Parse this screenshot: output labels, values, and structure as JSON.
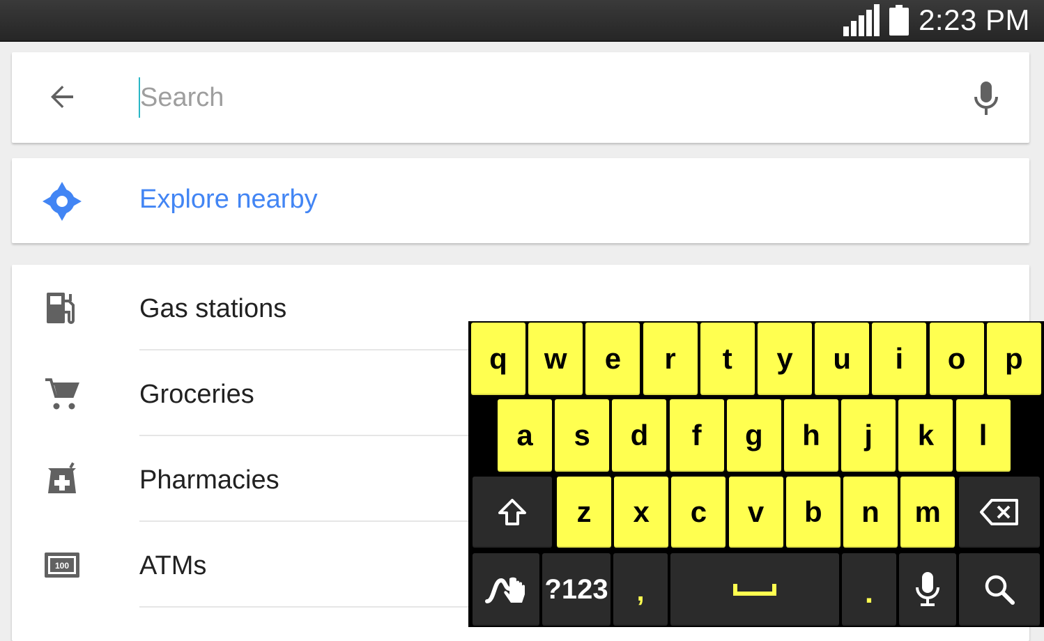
{
  "status_bar": {
    "time": "2:23 PM",
    "signal_icon": "signal-icon",
    "battery_icon": "battery-icon"
  },
  "search": {
    "placeholder": "Search",
    "value": "",
    "back_icon": "arrow-back-icon",
    "mic_icon": "microphone-icon"
  },
  "explore": {
    "label": "Explore nearby",
    "icon": "explore-compass-icon",
    "color": "#4285f4"
  },
  "categories": [
    {
      "label": "Gas stations",
      "icon": "gas-station-icon"
    },
    {
      "label": "Groceries",
      "icon": "shopping-cart-icon"
    },
    {
      "label": "Pharmacies",
      "icon": "pharmacy-icon"
    },
    {
      "label": "ATMs",
      "icon": "atm-icon",
      "icon_text": "100"
    }
  ],
  "keyboard": {
    "key_color": "#ffff50",
    "row1": [
      "q",
      "w",
      "e",
      "r",
      "t",
      "y",
      "u",
      "i",
      "o",
      "p"
    ],
    "row2": [
      "a",
      "s",
      "d",
      "f",
      "g",
      "h",
      "j",
      "k",
      "l"
    ],
    "row3": [
      "z",
      "x",
      "c",
      "v",
      "b",
      "n",
      "m"
    ],
    "symbols_label": "?123",
    "comma_label": ",",
    "period_label": ".",
    "icons": [
      "shift-icon",
      "backspace-icon",
      "swype-icon",
      "space-icon",
      "keyboard-mic-icon",
      "keyboard-search-icon"
    ]
  }
}
